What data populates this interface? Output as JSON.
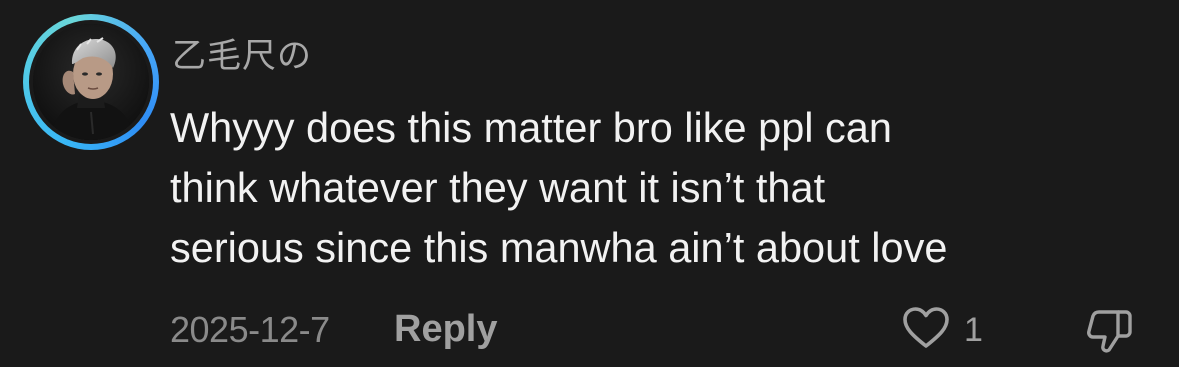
{
  "comment": {
    "username": "乙毛尺の",
    "text_lines": [
      "Whyyy does this matter bro like ppl can",
      "think whatever they want it isn’t that",
      "serious since this manwha ain’t about love"
    ],
    "date": "2025-12-7",
    "reply_label": "Reply",
    "like_count": "1",
    "avatar_ring_color": "#38b6f6",
    "icons": {
      "like": "heart-outline-icon",
      "dislike": "thumbs-down-icon"
    }
  }
}
